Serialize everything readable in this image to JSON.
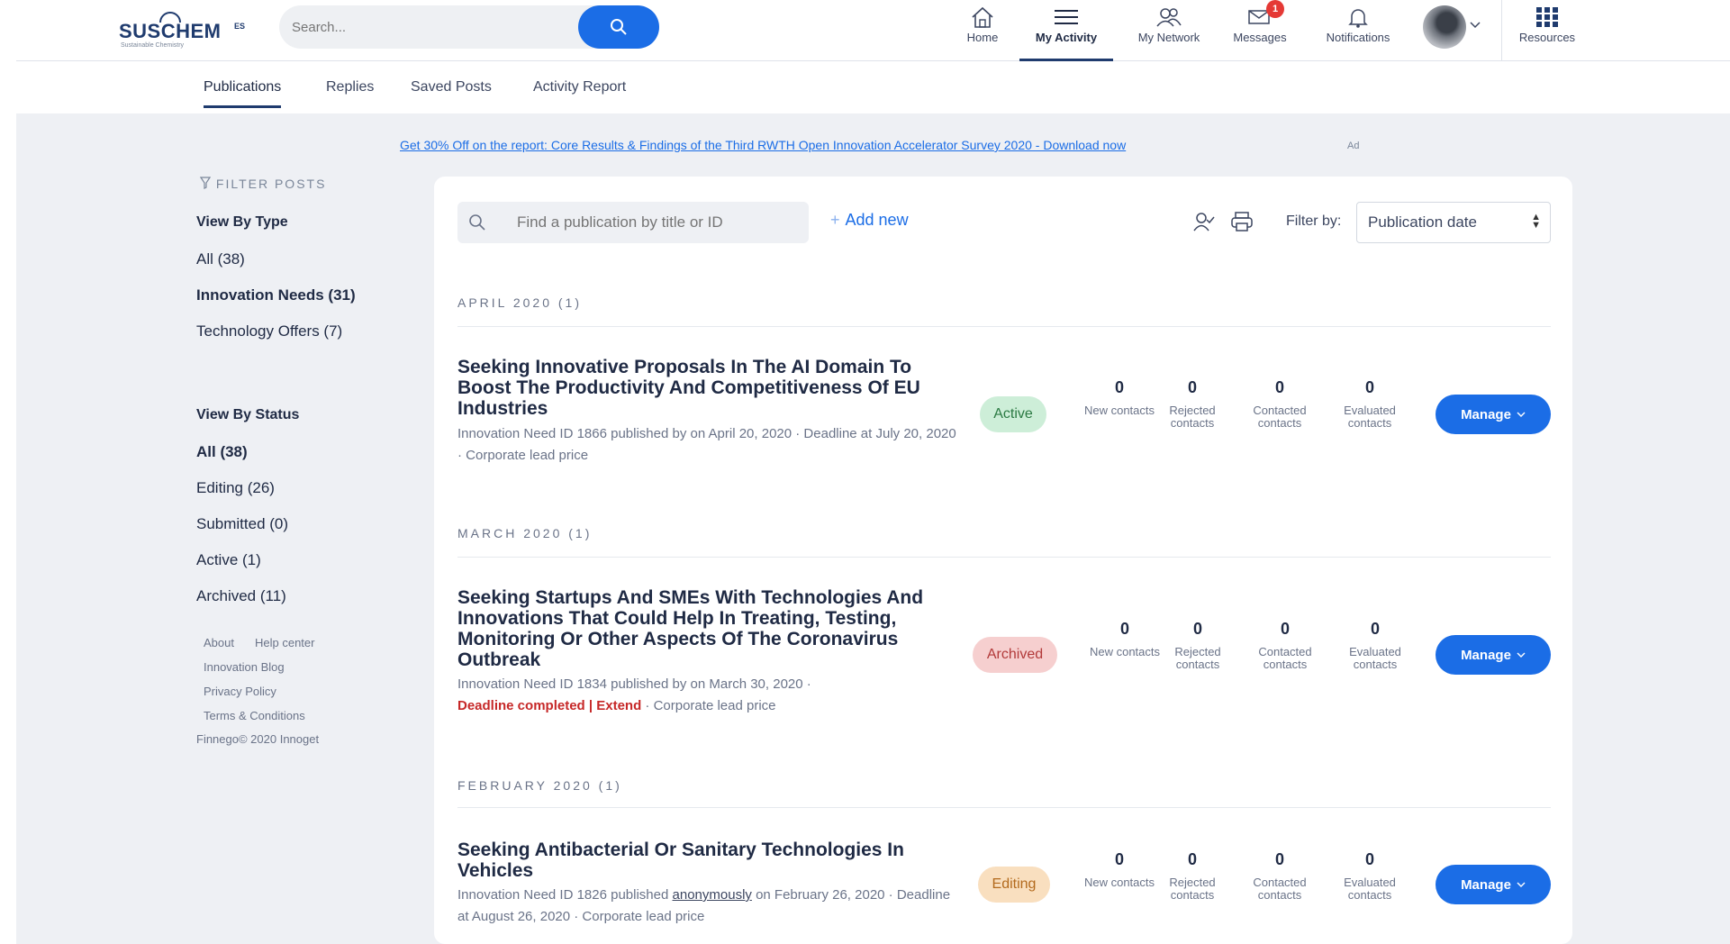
{
  "header": {
    "logo_text": "SUSCHEM",
    "logo_suffix": "ES",
    "logo_tagline": "Sustainable Chemistry",
    "search_placeholder": "Search...",
    "nav": [
      {
        "label": "Home",
        "icon": "home-icon"
      },
      {
        "label": "My Activity",
        "icon": "list-icon",
        "active": true
      },
      {
        "label": "My Network",
        "icon": "network-icon"
      },
      {
        "label": "Messages",
        "icon": "messages-icon",
        "badge": "1"
      },
      {
        "label": "Notifications",
        "icon": "bell-icon"
      },
      {
        "label": "Resources",
        "icon": "grid-icon"
      }
    ]
  },
  "subnav": {
    "tabs": [
      {
        "label": "Publications",
        "active": true
      },
      {
        "label": "Replies"
      },
      {
        "label": "Saved Posts"
      },
      {
        "label": "Activity Report"
      }
    ]
  },
  "promo": {
    "text": "Get 30% Off on the report: Core Results & Findings of the Third RWTH Open Innovation Accelerator Survey 2020 - Download now",
    "ad_label": "Ad"
  },
  "sidebar": {
    "heading": "FILTER POSTS",
    "view_by_type_title": "View By Type",
    "types": [
      {
        "label": "All (38)"
      },
      {
        "label": "Innovation Needs (31)",
        "bold": true
      },
      {
        "label": "Technology Offers (7)"
      }
    ],
    "view_by_status_title": "View By Status",
    "statuses": [
      {
        "label": "All (38)",
        "bold": true
      },
      {
        "label": "Editing (26)"
      },
      {
        "label": "Submitted (0)"
      },
      {
        "label": "Active (1)"
      },
      {
        "label": "Archived (11)"
      }
    ],
    "footer": {
      "about": "About",
      "help": "Help center",
      "blog": "Innovation Blog",
      "privacy": "Privacy Policy",
      "terms": "Terms & Conditions",
      "copyright": "Finnego© 2020 Innoget"
    }
  },
  "toolbar": {
    "find_placeholder": "Find a publication by title or ID",
    "add_new": "Add new",
    "filter_by_label": "Filter by:",
    "filter_value": "Publication date"
  },
  "stat_labels": {
    "new": "New contacts",
    "rejected": "Rejected contacts",
    "contacted": "Contacted contacts",
    "evaluated": "Evaluated contacts"
  },
  "groups": [
    {
      "month": "APRIL 2020 (1)",
      "pub": {
        "title": "Seeking Innovative Proposals In The AI Domain To Boost The Productivity And Competitiveness Of EU Industries",
        "meta": "Innovation Need ID 1866 published by on April 20, 2020 · Deadline at July 20, 2020 · Corporate lead price",
        "status": "Active",
        "new": "0",
        "rejected": "0",
        "contacted": "0",
        "evaluated": "0",
        "manage": "Manage"
      }
    },
    {
      "month": "MARCH 2020 (1)",
      "pub": {
        "title": "Seeking Startups And SMEs With Technologies And Innovations That Could Help In Treating, Testing, Monitoring Or Other Aspects Of The Coronavirus Outbreak",
        "meta_a": "Innovation Need ID 1834 published by on March 30, 2020 ·",
        "deadline_done": "Deadline completed | Extend",
        "meta_b": " · Corporate lead price",
        "status": "Archived",
        "new": "0",
        "rejected": "0",
        "contacted": "0",
        "evaluated": "0",
        "manage": "Manage"
      }
    },
    {
      "month": "FEBRUARY 2020 (1)",
      "pub": {
        "title": "Seeking Antibacterial Or Sanitary Technologies In Vehicles",
        "meta_a": "Innovation Need ID 1826 published ",
        "anon": "anonymously",
        "meta_b": " on February 26, 2020 · Deadline at August 26, 2020 · Corporate lead price",
        "status": "Editing",
        "new": "0",
        "rejected": "0",
        "contacted": "0",
        "evaluated": "0",
        "manage": "Manage"
      }
    }
  ],
  "colors": {
    "primary": "#1b6de6",
    "navy": "#1f3b6e",
    "background": "#eef0f4",
    "active_bg": "#cdeed8",
    "archived_bg": "#f6cfcf",
    "editing_bg": "#f9dfbf",
    "alert": "#c62828"
  }
}
